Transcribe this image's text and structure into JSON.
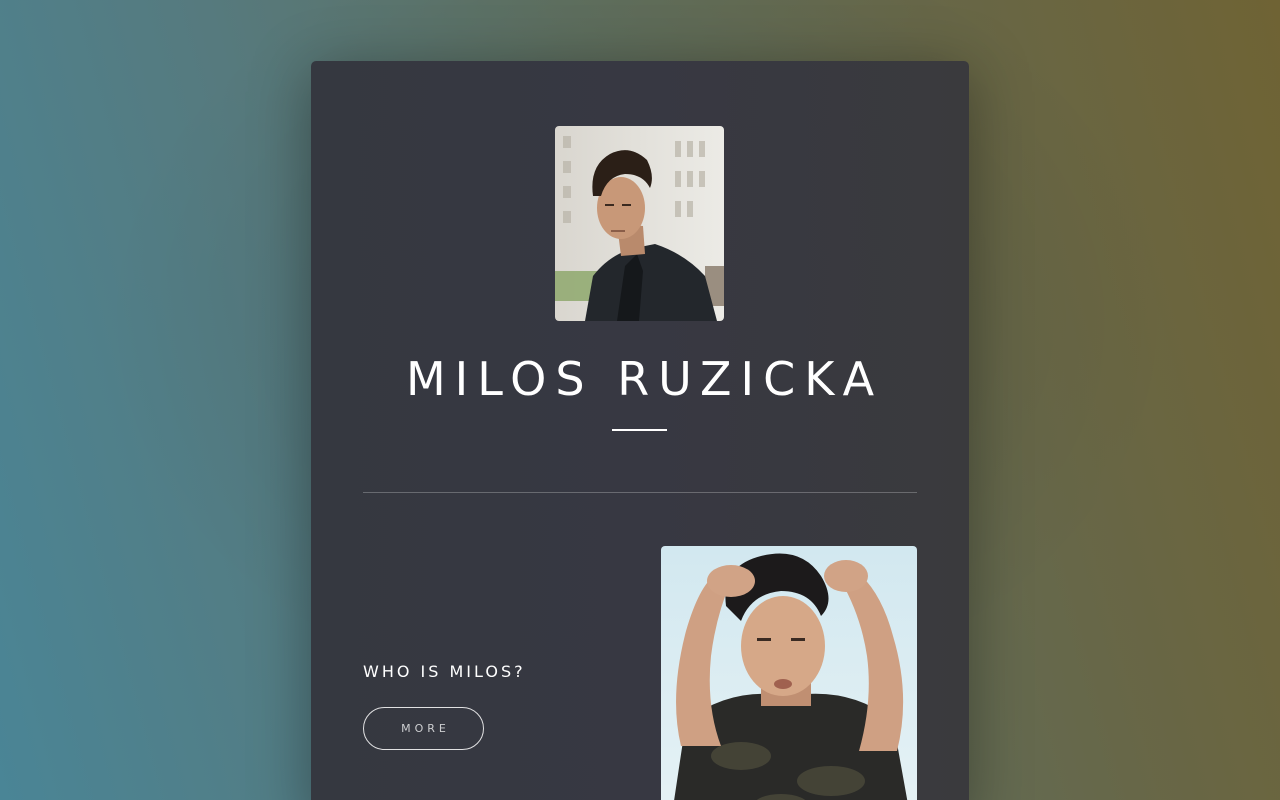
{
  "profile": {
    "name": "MILOS RUZICKA",
    "avatar_alt": "portrait-photo"
  },
  "about": {
    "heading": "WHO IS MILOS?",
    "more_label": "MORE",
    "photo_alt": "portrait-photo-hands-in-hair"
  },
  "colors": {
    "card_bg": "#37383f",
    "text": "#ffffff",
    "bg_left": "#4a8596",
    "bg_right": "#6f6334"
  }
}
